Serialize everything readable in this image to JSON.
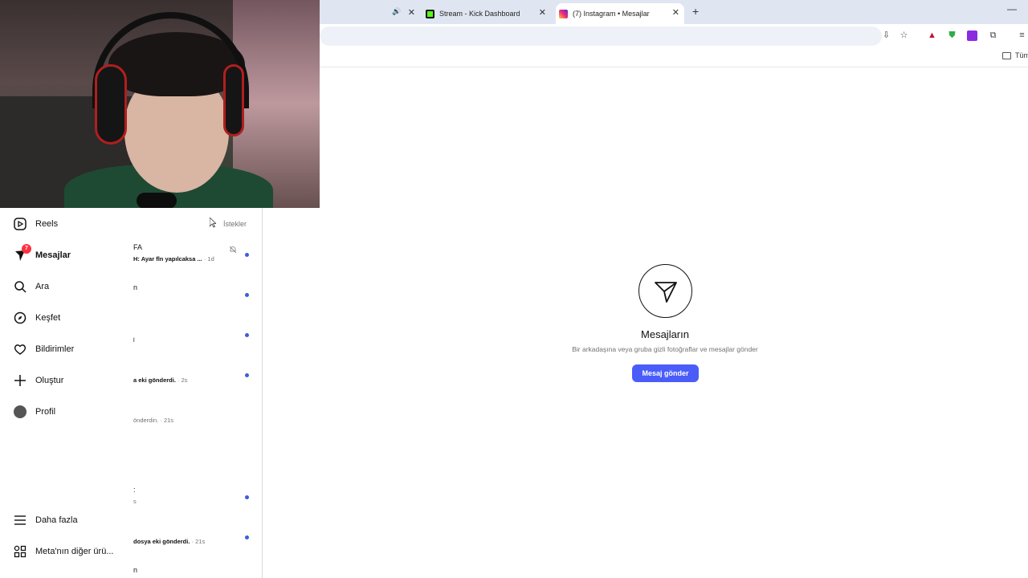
{
  "browser": {
    "tabs": [
      {
        "title": "",
        "favicon": "speaker-icon"
      },
      {
        "title": "Stream - Kick Dashboard",
        "favicon": "kick-logo"
      },
      {
        "title": "(7) Instagram • Mesajlar",
        "favicon": "instagram-logo",
        "active": true
      }
    ],
    "bookmark_folder": "Tüm"
  },
  "sidebar": {
    "items": [
      {
        "label": "Reels",
        "icon": "reels-icon"
      },
      {
        "label": "Mesajlar",
        "icon": "messenger-icon",
        "badge": "7",
        "active": true
      },
      {
        "label": "Ara",
        "icon": "search-icon"
      },
      {
        "label": "Keşfet",
        "icon": "compass-icon"
      },
      {
        "label": "Bildirimler",
        "icon": "heart-icon"
      },
      {
        "label": "Oluştur",
        "icon": "plus-icon"
      },
      {
        "label": "Profil",
        "icon": "avatar"
      }
    ],
    "more": "Daha fazla",
    "meta": "Meta'nın diğer ürü..."
  },
  "messages": {
    "requests_label": "İstekler",
    "rows": [
      {
        "name": "FA",
        "preview": "H: Ayar fln yapılcaksa ...",
        "time": " · 1d",
        "muted": true,
        "unread": true
      },
      {
        "name": "n",
        "preview": "",
        "time": "",
        "unread": true
      },
      {
        "name": "",
        "preview": "l",
        "time": "",
        "unread": true
      },
      {
        "name": "",
        "preview": "a eki gönderdi.",
        "time": " · 2s",
        "unread": true
      },
      {
        "name": "",
        "preview": "önderdin.",
        "time": " · 21s",
        "unread": false
      },
      {
        "name": "",
        "preview": "s",
        "time": "",
        "unread": true
      },
      {
        "name": "",
        "preview": "dosya eki gönderdi.",
        "time": " · 21s",
        "unread": true
      },
      {
        "name": "n",
        "preview": "",
        "time": "",
        "unread": false
      }
    ]
  },
  "empty_state": {
    "title": "Mesajların",
    "subtitle": "Bir arkadaşına veya gruba gizli fotoğraflar ve mesajlar gönder",
    "button": "Mesaj gönder"
  },
  "colors": {
    "accent": "#4a5df9",
    "unread_dot": "#3e5bdb",
    "badge": "#ff3040",
    "tabbar": "#dfe5f1"
  }
}
